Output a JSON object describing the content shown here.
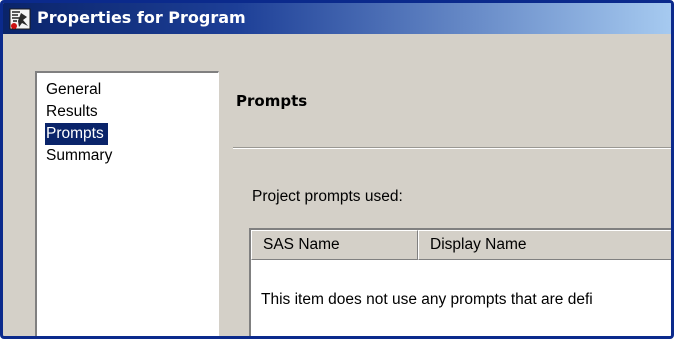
{
  "window": {
    "title": "Properties for Program",
    "icon": "program-icon"
  },
  "nav": {
    "items": [
      {
        "label": "General",
        "selected": false
      },
      {
        "label": "Results",
        "selected": false
      },
      {
        "label": "Prompts",
        "selected": true
      },
      {
        "label": "Summary",
        "selected": false
      }
    ]
  },
  "page": {
    "section_title": "Prompts",
    "prompts_label": "Project prompts used:",
    "table": {
      "columns": [
        "SAS Name",
        "Display Name"
      ],
      "empty_message": "This item does not use any prompts that are defi"
    }
  },
  "colors": {
    "titlebar": "#0a246a",
    "selection": "#0a246a",
    "dialog_face": "#d4d0c8"
  }
}
